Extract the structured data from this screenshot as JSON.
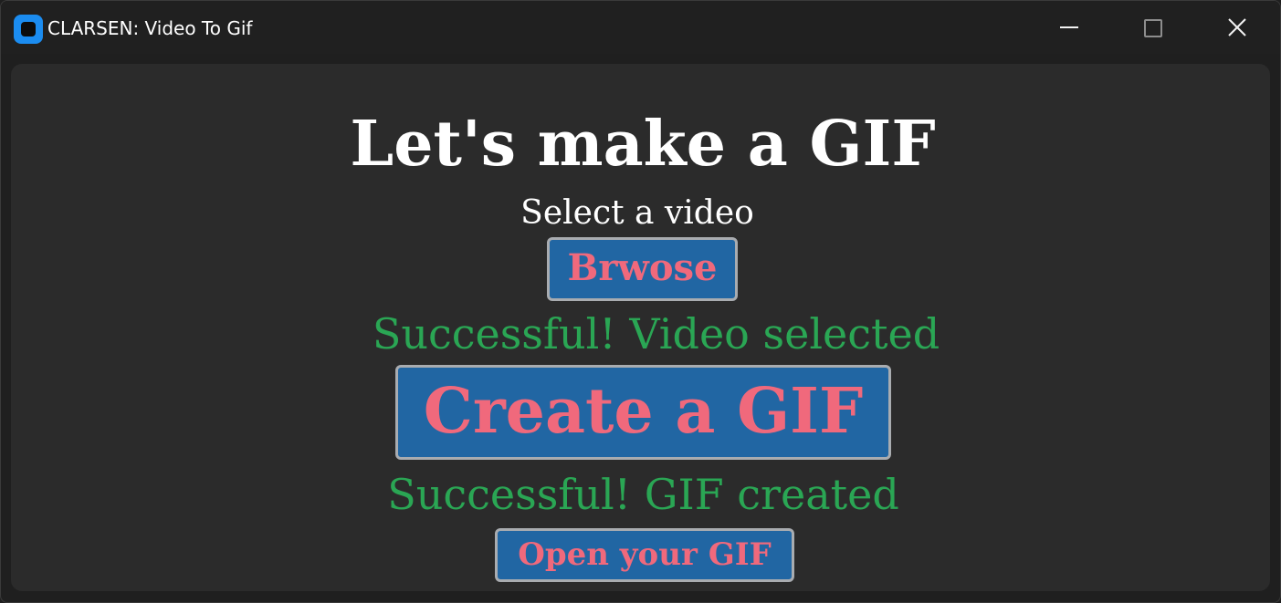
{
  "window": {
    "title": "CLARSEN: Video To Gif",
    "icon": "app-icon",
    "controls": {
      "minimize": "minimize-icon",
      "maximize": "maximize-icon",
      "close": "close-icon"
    }
  },
  "main": {
    "heading": "Let's make a GIF",
    "select_label": "Select a video",
    "browse_button": "Brwose",
    "video_status": "Successful! Video selected",
    "create_button": "Create a GIF",
    "gif_status": "Successful! GIF created",
    "open_button": "Open your GIF"
  },
  "colors": {
    "window_background": "#1f1f1f",
    "content_background": "#2b2b2b",
    "button_background": "#2166a3",
    "button_border": "#a9acb0",
    "button_text": "#f0697c",
    "success_text": "#2aa654",
    "app_icon": "#1b8cf0"
  }
}
